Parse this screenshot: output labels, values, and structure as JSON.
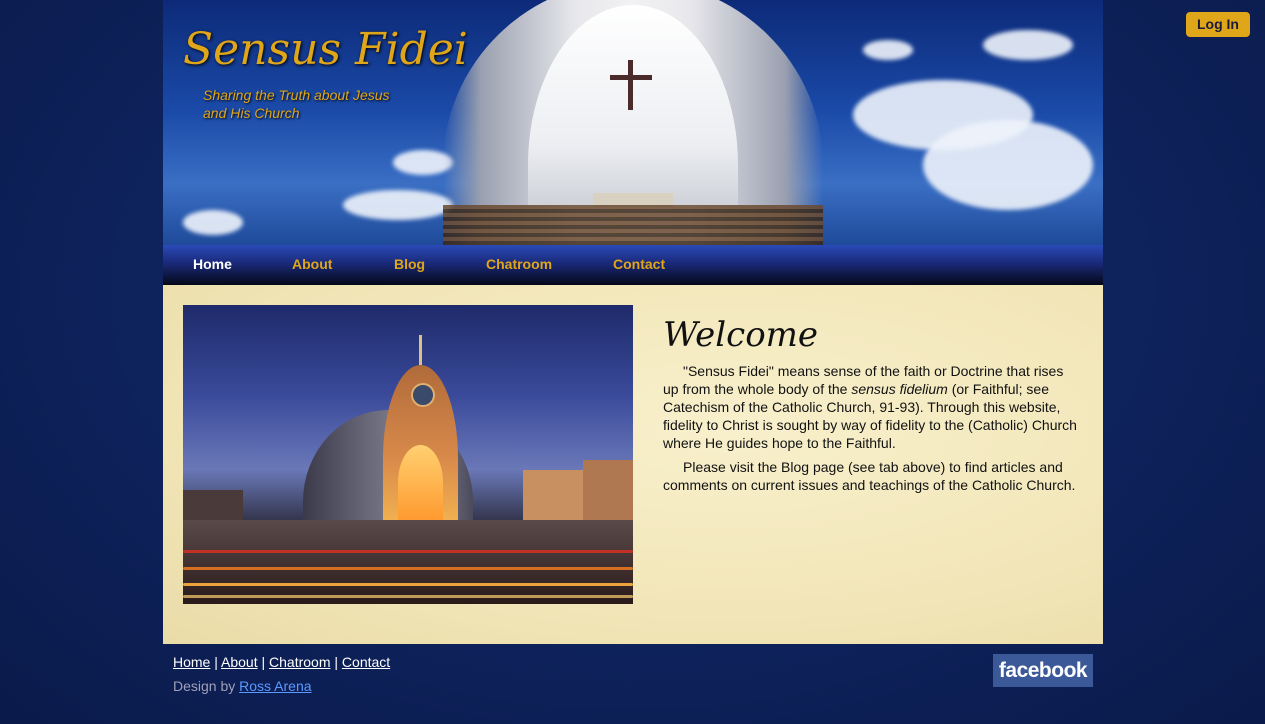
{
  "header": {
    "login_label": "Log In",
    "site_title": "Sensus Fidei",
    "tagline": "Sharing the Truth about Jesus and His Church"
  },
  "nav": {
    "items": [
      {
        "label": "Home",
        "active": true
      },
      {
        "label": "About",
        "active": false
      },
      {
        "label": "Blog",
        "active": false
      },
      {
        "label": "Chatroom",
        "active": false
      },
      {
        "label": "Contact",
        "active": false
      }
    ]
  },
  "main": {
    "heading": "Welcome",
    "para1_a": "\"Sensus Fidei\" means sense of the faith or Doctrine that rises up from the whole body of the ",
    "para1_italic": "sensus fidelium",
    "para1_b": " (or Faithful; see Catechism of the Catholic Church, 91-93). Through this website, fidelity to Christ is sought by way of fidelity to the (Catholic) Church where He guides hope to the Faithful.",
    "para2": "Please visit the Blog page (see tab above) to find articles and comments on current issues and teachings of the Catholic Church."
  },
  "footer": {
    "links": [
      "Home",
      "About",
      "Chatroom",
      "Contact"
    ],
    "separator": " | ",
    "design_prefix": "Design by ",
    "designer": "Ross Arena",
    "facebook_label": "facebook"
  },
  "colors": {
    "accent": "#e0a61a",
    "facebook": "#3b5998",
    "link": "#5a9aff"
  }
}
